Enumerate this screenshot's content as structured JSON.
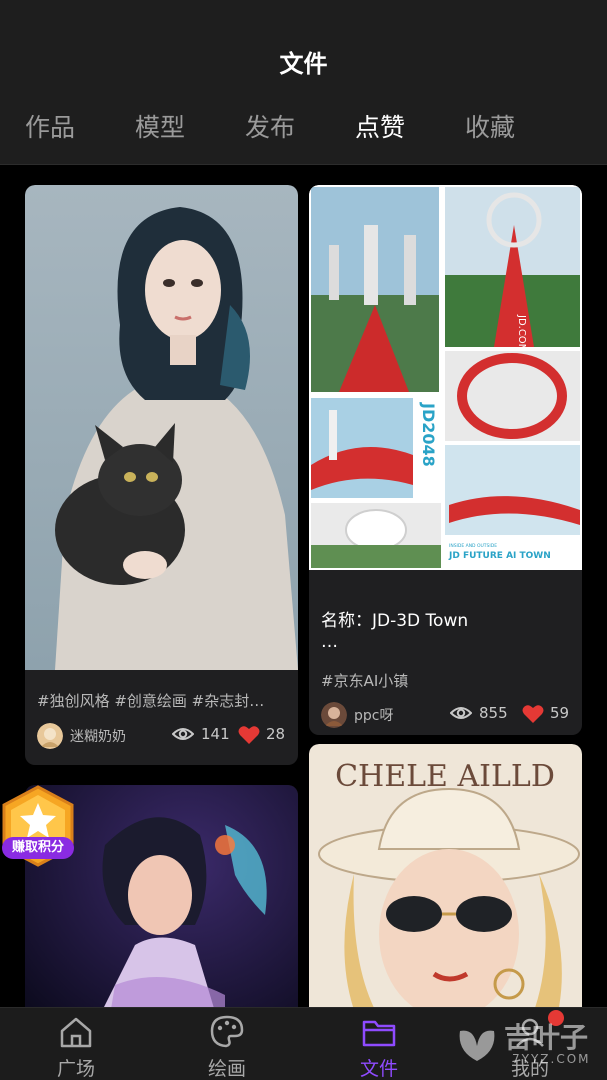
{
  "header": {
    "title": "文件",
    "tabs": [
      {
        "label": "作品",
        "active": false
      },
      {
        "label": "模型",
        "active": false
      },
      {
        "label": "发布",
        "active": false
      },
      {
        "label": "点赞",
        "active": true
      },
      {
        "label": "收藏",
        "active": false
      }
    ]
  },
  "cards": [
    {
      "tags": "#独创风格 #创意绘画 #杂志封…",
      "author": "迷糊奶奶",
      "views": "141",
      "likes": "28",
      "image_desc_icon": "girl-with-cat-image"
    },
    {
      "name": "名称：JD-3D Town",
      "name_more": "…",
      "tags": "#京东AI小镇",
      "author": "ppc呀",
      "views": "855",
      "likes": "59",
      "image_texts": {
        "vertical": "JD2048",
        "logo": "JD.COM",
        "small_top": "INSIDE AND OUTSIDE",
        "caption": "JD FUTURE AI TOWN"
      }
    },
    {
      "image_desc_icon": "dancer-girl-image"
    },
    {
      "image_text": "CHELE AILLD",
      "image_desc_icon": "girl-with-hat-image"
    }
  ],
  "earn_badge": {
    "label": "赚取积分"
  },
  "bottom_nav": [
    {
      "label": "广场",
      "icon": "home-icon",
      "active": false
    },
    {
      "label": "绘画",
      "icon": "palette-icon",
      "active": false
    },
    {
      "label": "文件",
      "icon": "folder-icon",
      "active": true
    },
    {
      "label": "我的",
      "icon": "profile-icon",
      "active": false,
      "badge": true
    }
  ],
  "watermark": {
    "text": "吉叶子",
    "sub": "7YYZ.COM"
  },
  "colors": {
    "accent": "#8f4bff",
    "like": "#e53935",
    "card_bg": "#1f1f21",
    "header_bg": "#1e1e1e"
  }
}
